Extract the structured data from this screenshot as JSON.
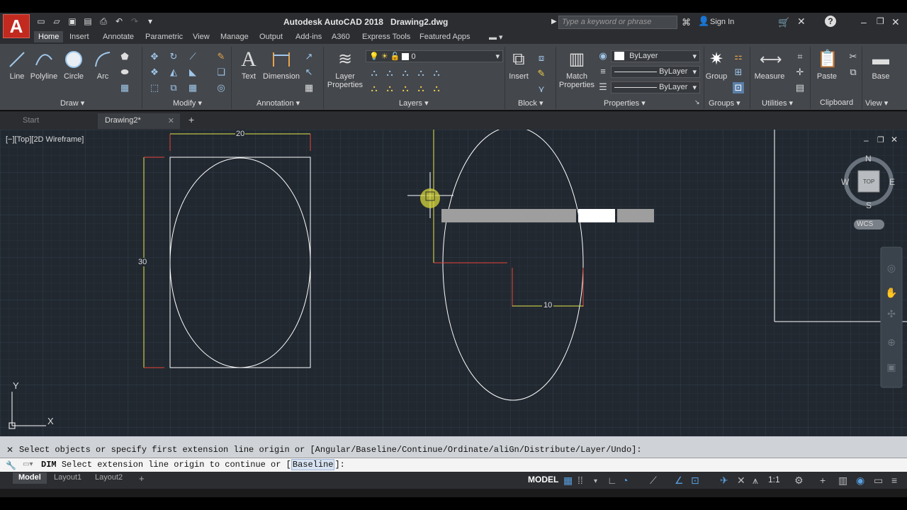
{
  "window": {
    "app_name": "Autodesk AutoCAD 2018",
    "file_name": "Drawing2.dwg",
    "search_placeholder": "Type a keyword or phrase",
    "sign_in": "Sign In",
    "app_letter": "A"
  },
  "ribbon_tabs": [
    "Home",
    "Insert",
    "Annotate",
    "Parametric",
    "View",
    "Manage",
    "Output",
    "Add-ins",
    "A360",
    "Express Tools",
    "Featured Apps"
  ],
  "draw_tools": [
    "Line",
    "Polyline",
    "Circle",
    "Arc"
  ],
  "annotation_tools": [
    "Text",
    "Dimension"
  ],
  "layer_tool": {
    "line1": "Layer",
    "line2": "Properties"
  },
  "layer_value": "0",
  "block_tool": "Insert",
  "match_tool": {
    "line1": "Match",
    "line2": "Properties"
  },
  "property_values": [
    "ByLayer",
    "ByLayer",
    "ByLayer"
  ],
  "group_tool": "Group",
  "measure_tool": "Measure",
  "paste_tool": "Paste",
  "base_tool": "Base",
  "group_labels": [
    "Draw",
    "Modify",
    "Annotation",
    "Layers",
    "Block",
    "Properties",
    "Groups",
    "Utilities",
    "Clipboard",
    "View"
  ],
  "doc_tabs": [
    "Start",
    "Drawing2*"
  ],
  "viewport_label": "[−][Top][2D Wireframe]",
  "dimensions": {
    "top": "20",
    "left": "30",
    "right": "10"
  },
  "viewcube": {
    "n": "N",
    "s": "S",
    "e": "E",
    "w": "W",
    "top": "TOP",
    "wcs": "WCS"
  },
  "ucs": {
    "x": "X",
    "y": "Y"
  },
  "command": {
    "history": "Select objects or specify first extension line origin or [Angular/Baseline/Continue/Ordinate/aliGn/Distribute/Layer/Undo]:",
    "prefix": "DIM",
    "prompt": "Select extension line origin to continue or [",
    "option": "Baseline",
    "suffix": "]:"
  },
  "layout_tabs": [
    "Model",
    "Layout1",
    "Layout2"
  ],
  "status": {
    "model": "MODEL",
    "scale": "1:1"
  }
}
